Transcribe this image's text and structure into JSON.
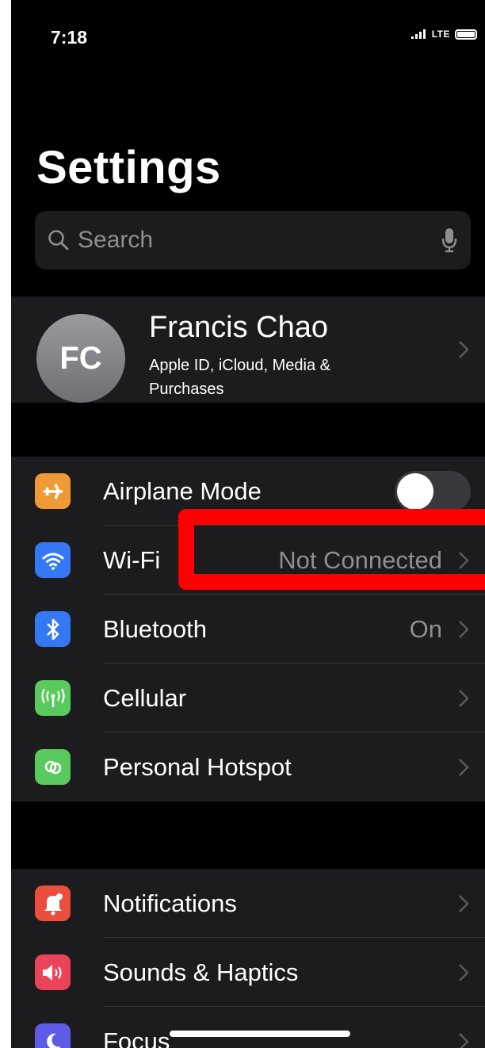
{
  "status_bar": {
    "time": "7:18",
    "network": "LTE",
    "signal_icon": "cell-signal-icon",
    "battery_icon": "battery-icon"
  },
  "header": {
    "title": "Settings"
  },
  "search": {
    "placeholder": "Search",
    "search_icon": "magnifier-icon",
    "mic_icon": "microphone-icon"
  },
  "profile": {
    "initials": "FC",
    "name": "Francis Chao",
    "subtitle": "Apple ID, iCloud, Media & Purchases"
  },
  "connectivity": {
    "items": [
      {
        "label": "Airplane Mode",
        "value": "",
        "icon": "airplane-icon",
        "color": "#f09a37",
        "toggle": true,
        "toggle_on": false
      },
      {
        "label": "Wi-Fi",
        "value": "Not Connected",
        "icon": "wifi-icon",
        "color": "#3478f6"
      },
      {
        "label": "Bluetooth",
        "value": "On",
        "icon": "bluetooth-icon",
        "color": "#3478f6"
      },
      {
        "label": "Cellular",
        "value": "",
        "icon": "cellular-antenna-icon",
        "color": "#5ac95e"
      },
      {
        "label": "Personal Hotspot",
        "value": "",
        "icon": "hotspot-icon",
        "color": "#5ac95e"
      }
    ]
  },
  "system": {
    "items": [
      {
        "label": "Notifications",
        "value": "",
        "icon": "notification-bell-icon",
        "color": "#eb4e3d"
      },
      {
        "label": "Sounds & Haptics",
        "value": "",
        "icon": "speaker-icon",
        "color": "#eb445a"
      },
      {
        "label": "Focus",
        "value": "",
        "icon": "moon-icon",
        "color": "#5e5ce6"
      }
    ]
  },
  "annotation": {
    "highlight_color": "#ff0000"
  }
}
